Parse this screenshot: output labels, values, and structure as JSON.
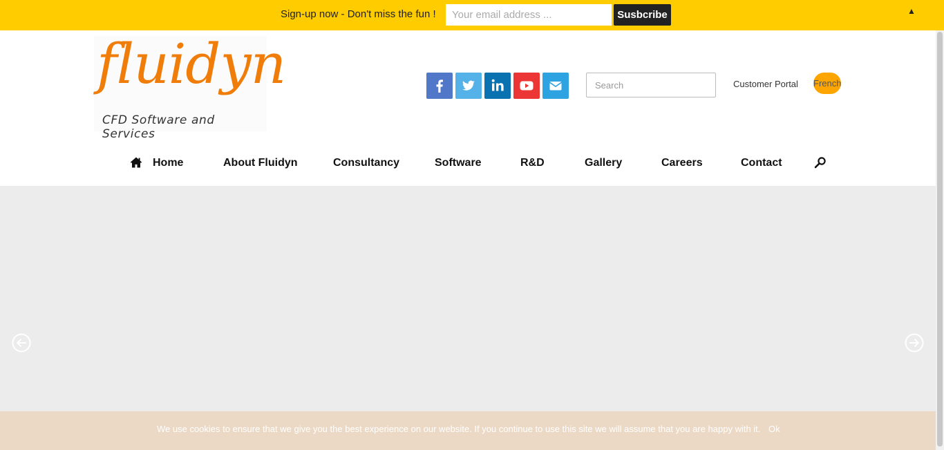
{
  "signup_bar": {
    "message": "Sign-up now - Don't miss the fun !",
    "email_placeholder": "Your email address ...",
    "subscribe_label": "Susbcribe",
    "collapse_glyph": "▲",
    "background_color": "#ffcc00"
  },
  "header": {
    "logo": {
      "script_text": "fluidyn",
      "tagline": "CFD Software and Services",
      "color": "#f07d0a"
    },
    "social": [
      {
        "name": "facebook",
        "icon": "facebook-icon",
        "color": "#5177c9"
      },
      {
        "name": "twitter",
        "icon": "twitter-icon",
        "color": "#55b2e8"
      },
      {
        "name": "linkedin",
        "icon": "linkedin-icon",
        "color": "#0a72b1"
      },
      {
        "name": "youtube",
        "icon": "youtube-icon",
        "color": "#ec3636"
      },
      {
        "name": "email",
        "icon": "envelope-icon",
        "color": "#2da3e2"
      }
    ],
    "search_placeholder": "Search",
    "customer_portal_label": "Customer Portal",
    "language_label": "French",
    "language_color": "#ffa500"
  },
  "nav": {
    "home": "Home",
    "about": "About Fluidyn",
    "consultancy": "Consultancy",
    "software": "Software",
    "rnd": "R&D",
    "gallery": "Gallery",
    "careers": "Careers",
    "contact": "Contact"
  },
  "slider": {
    "background_color": "#ececec",
    "prev_icon": "arrow-left-circle-icon",
    "next_icon": "arrow-right-circle-icon"
  },
  "cookie_banner": {
    "text": "We use cookies to ensure that we give you the best experience on our website. If you continue to use this site we will assume that you are happy with it.",
    "ok_label": "Ok",
    "background_color": "#ebd9c6"
  }
}
